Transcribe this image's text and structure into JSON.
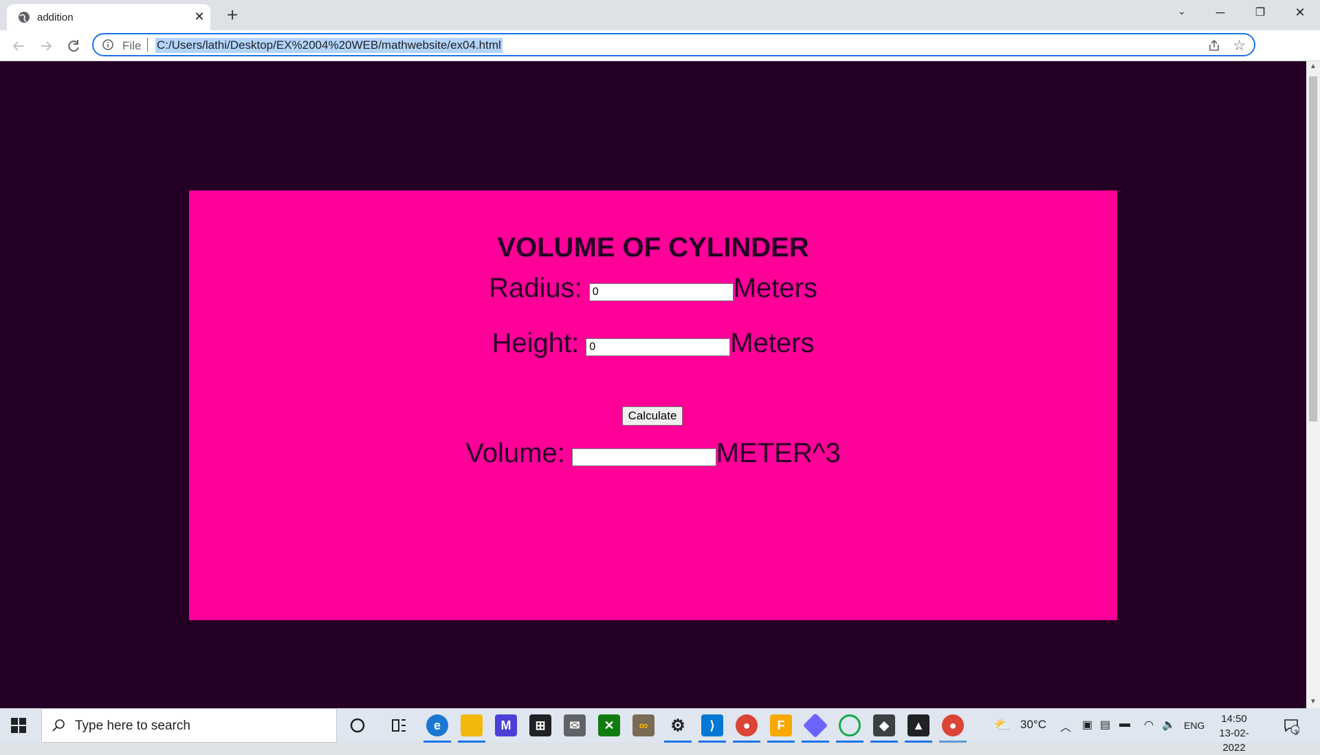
{
  "browser": {
    "tab_title": "addition",
    "url_scheme": "File",
    "url": "C:/Users/lathi/Desktop/EX%2004%20WEB/mathwebsite/ex04.html"
  },
  "page": {
    "heading": "VOLUME OF CYLINDER",
    "radius": {
      "label": "Radius:",
      "value": "0",
      "unit": "Meters"
    },
    "height": {
      "label": "Height:",
      "value": "0",
      "unit": "Meters"
    },
    "calculate_label": "Calculate",
    "volume": {
      "label": "Volume:",
      "value": "",
      "unit": "METER^3"
    },
    "colors": {
      "background": "#240024",
      "card": "#ff0099",
      "text": "#240024"
    }
  },
  "taskbar": {
    "search_placeholder": "Type here to search",
    "weather": "30°C",
    "language": "ENG",
    "time": "14:50",
    "date": "13-02-2022",
    "notification_count": "3",
    "pinned_apps": [
      "cortana-icon",
      "task-view-icon",
      "edge-icon",
      "file-explorer-icon",
      "visual-studio-icon",
      "store-icon",
      "mail-icon",
      "xbox-icon",
      "app-icon",
      "settings-icon",
      "vscode-icon",
      "chrome-icon",
      "app-f-icon",
      "app-diamond-icon",
      "app-ring-icon",
      "app-cube-icon",
      "photos-icon",
      "chrome-active-icon"
    ]
  }
}
